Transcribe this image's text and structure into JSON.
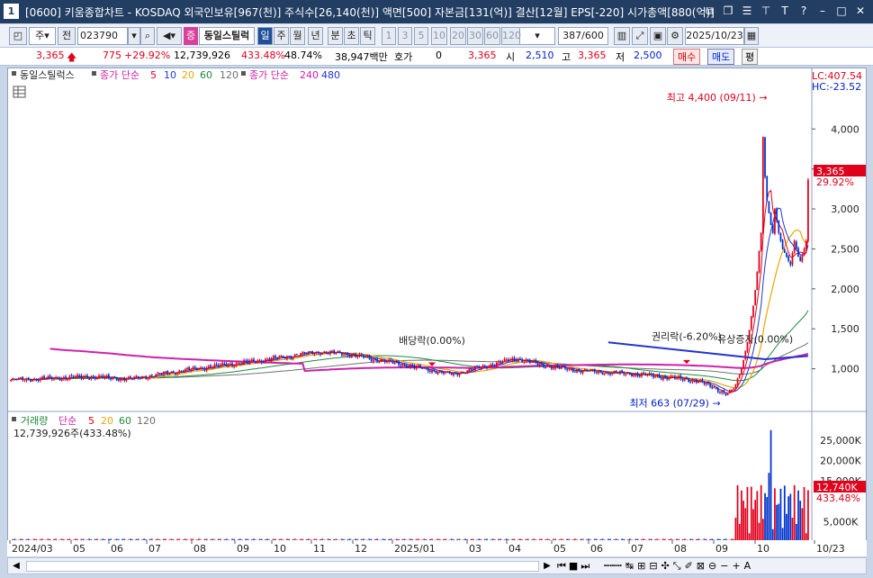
{
  "window": {
    "number": "1",
    "title": "[0600] 키움종합차트 - KOSDAQ 외국인보유[967(천)] 주식수[26,140(천)] 액면[500] 자본금[131(억)] 결산[12월] EPS[-220] 시가총액[880(억)]"
  },
  "toolbar": {
    "type_select": "주",
    "prev_label": "전",
    "code": "023790",
    "stock_badge": "증",
    "stock_name": "동일스틸럭",
    "period_tabs": [
      "일",
      "주",
      "월",
      "년",
      "분",
      "초",
      "틱"
    ],
    "active_period": "일",
    "minute_buttons": [
      "1",
      "3",
      "5",
      "10",
      "20",
      "30",
      "60",
      "120"
    ],
    "count": "387",
    "count_max": "/600",
    "date": "2025/10/23"
  },
  "quote": {
    "price": "3,365",
    "change": "775",
    "change_pct": "+29.92%",
    "volume": "12,739,926",
    "volume_pct": "433.48%",
    "turnover": "48.74%",
    "amount": "38,947백만",
    "hoga_label": "호가",
    "hoga_value": "0",
    "hoga_price": "3,365",
    "open_label": "시",
    "open": "2,510",
    "high_label": "고",
    "high": "3,365",
    "low_label": "저",
    "low": "2,500",
    "buy_label": "매수",
    "sell_label": "매도",
    "eval_label": "평"
  },
  "price_panel": {
    "stock_label": "동일스틸럭스",
    "ma_label": "종가 단순",
    "ma_periods": [
      "5",
      "10",
      "20",
      "60",
      "120"
    ],
    "ma2_label": "종가 단순",
    "ma2_periods": [
      "240",
      "480"
    ],
    "lc": "LC:407.54",
    "hc": "HC:-23.52",
    "current_price_tag": "3,365",
    "current_pct_tag": "29.92%",
    "annotations": {
      "high": "최고 4,400 (09/11)",
      "low": "최저 663 (07/29)",
      "dividend": "배당락(0.00%)",
      "rights": "권리락(-6.20%)",
      "capital": "유상증자(0.00%)"
    }
  },
  "volume_panel": {
    "label": "거래량",
    "ma_label": "단순",
    "ma_periods": [
      "5",
      "20",
      "60",
      "120"
    ],
    "value_text": "12,739,926주(433.48%)",
    "current_tag": "12,740K",
    "current_pct_tag": "433.48%"
  },
  "chart_data": {
    "type": "candlestick",
    "price_axis": [
      "4,000",
      "3,500",
      "3,000",
      "2,500",
      "2,000",
      "1,500",
      "1,000"
    ],
    "price_axis_values": [
      4000,
      3500,
      3000,
      2500,
      2000,
      1500,
      1000
    ],
    "volume_axis": [
      "25,000K",
      "20,000K",
      "15,000K",
      "5,000K"
    ],
    "volume_axis_values": [
      25000,
      20000,
      15000,
      5000
    ],
    "x_labels": [
      "2024/03",
      "05",
      "06",
      "07",
      "08",
      "09",
      "10",
      "11",
      "12",
      "2025/01",
      "03",
      "04",
      "05",
      "06",
      "07",
      "08",
      "09",
      "10",
      "10/23"
    ],
    "price_ylim": [
      500,
      4600
    ],
    "volume_ylim": [
      0,
      29000
    ],
    "close_series_approx": [
      {
        "date": "2024/03",
        "close": 870
      },
      {
        "date": "2024/05",
        "close": 900
      },
      {
        "date": "2024/06",
        "close": 880
      },
      {
        "date": "2024/07",
        "close": 1000
      },
      {
        "date": "2024/08",
        "close": 1050
      },
      {
        "date": "2024/09",
        "close": 1150
      },
      {
        "date": "2024/10",
        "close": 1230
      },
      {
        "date": "2024/11",
        "close": 1160
      },
      {
        "date": "2024/12",
        "close": 1030
      },
      {
        "date": "2025/01",
        "close": 950
      },
      {
        "date": "2025/02",
        "close": 1150
      },
      {
        "date": "2025/03",
        "close": 1050
      },
      {
        "date": "2025/04",
        "close": 1000
      },
      {
        "date": "2025/05",
        "close": 900
      },
      {
        "date": "2025/06",
        "close": 860
      },
      {
        "date": "2025/07",
        "close": 700
      },
      {
        "date": "2025/08",
        "close": 1400
      },
      {
        "date": "2025/09",
        "close": 4400
      },
      {
        "date": "2025/10",
        "close": 2300
      },
      {
        "date": "10/23",
        "close": 3365
      }
    ],
    "volume_series_approx": [
      {
        "date": "2025/08",
        "volume": 17000
      },
      {
        "date": "2025/09",
        "volume": 27500
      },
      {
        "date": "2025/10",
        "volume": 12740
      }
    ]
  },
  "colors": {
    "up": "#e0001b",
    "down": "#0033cc",
    "ma5": "#e0001b",
    "ma10": "#1a3bd1",
    "ma20": "#e6a800",
    "ma60": "#1f8a3c",
    "ma120": "#707070",
    "ma240": "#cc22aa",
    "ma480": "#2233cc",
    "title_bg": "#233e63"
  }
}
